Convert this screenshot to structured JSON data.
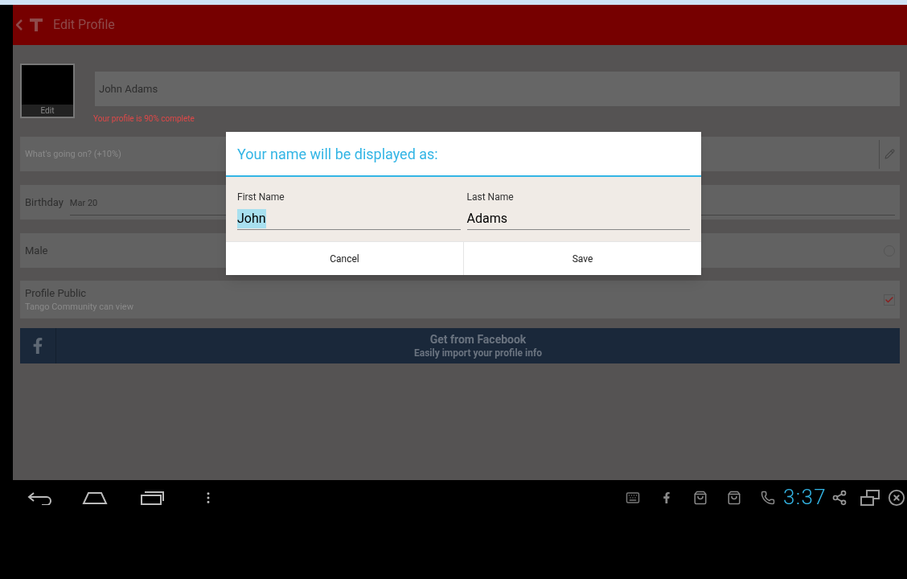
{
  "app_bar": {
    "title": "Edit Profile"
  },
  "profile": {
    "photo_label": "Edit",
    "name": "John Adams",
    "completion": "Your profile is 90% complete"
  },
  "status_field": {
    "placeholder": "What's going on? (+10%)"
  },
  "birthday": {
    "label": "Birthday",
    "value": "Mar 20"
  },
  "gender": {
    "label": "Male",
    "selected": false
  },
  "privacy": {
    "label": "Profile Public",
    "sublabel": "Tango Community can view",
    "checked": true
  },
  "facebook": {
    "title": "Get from Facebook",
    "subtitle": "Easily import your profile info"
  },
  "dialog": {
    "title": "Your name will be displayed as:",
    "fields": [
      {
        "label": "First Name",
        "value": "John",
        "selected": true
      },
      {
        "label": "Last Name",
        "value": "Adams",
        "selected": false
      }
    ],
    "buttons": [
      "Cancel",
      "Save"
    ]
  },
  "system_bar": {
    "time": "3:37"
  }
}
